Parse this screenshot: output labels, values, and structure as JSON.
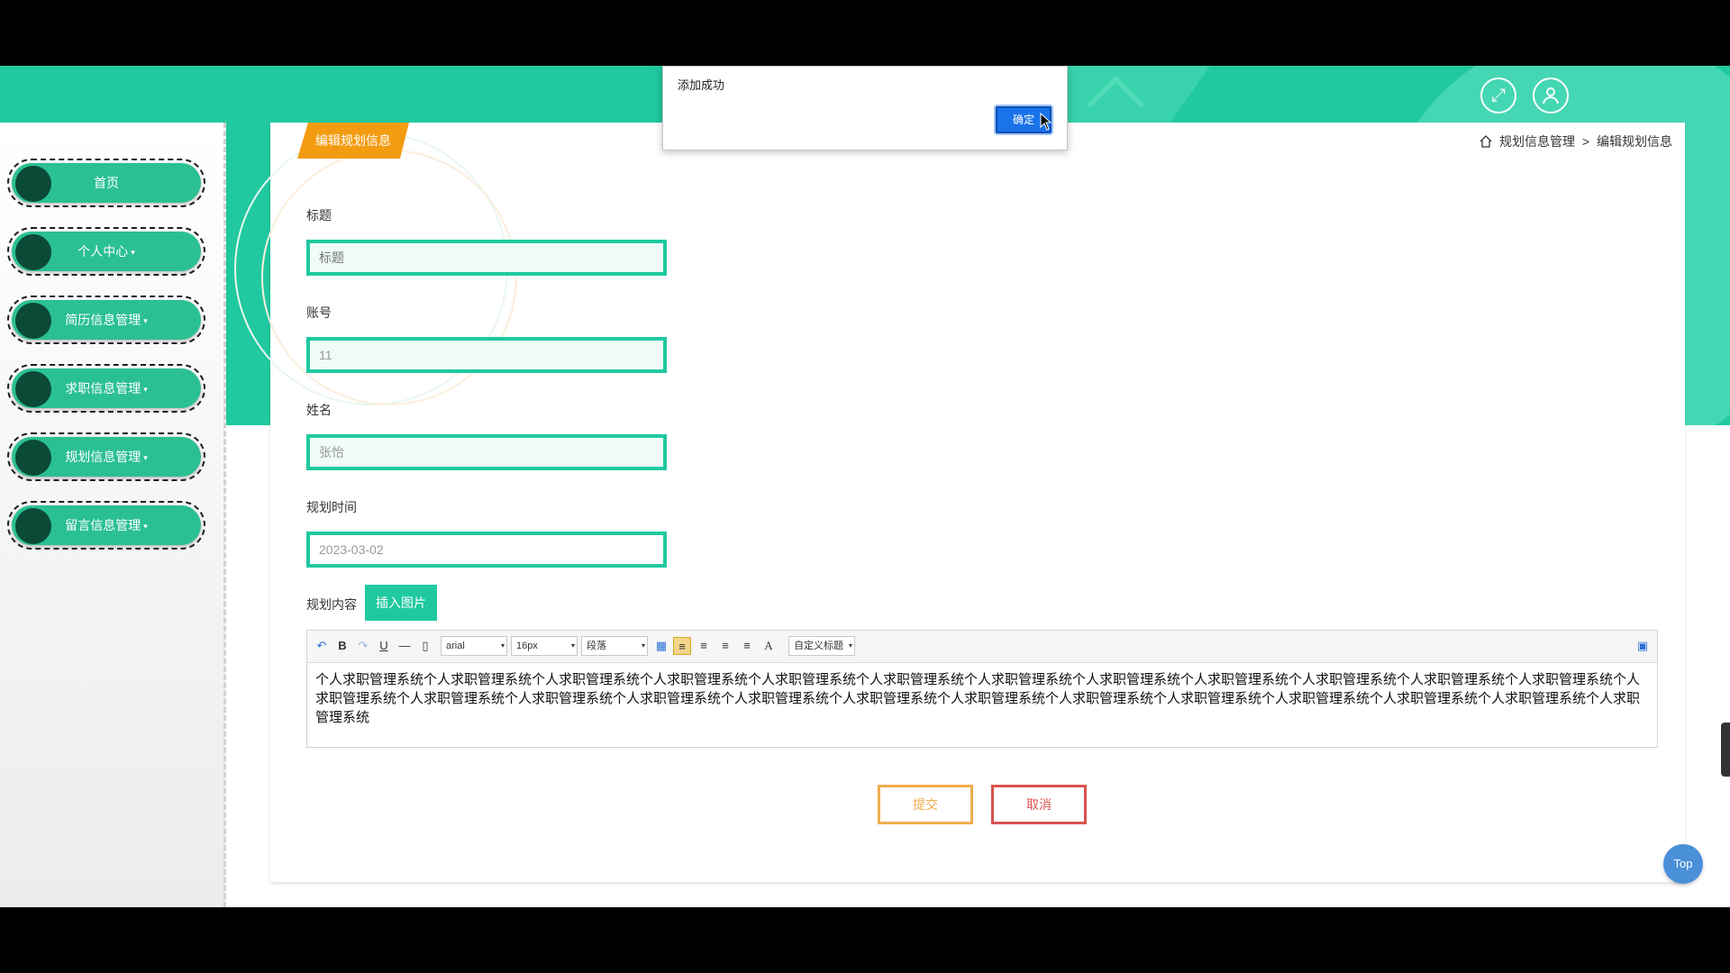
{
  "sidebar": {
    "items": [
      {
        "label": "首页",
        "caret": ""
      },
      {
        "label": "个人中心",
        "caret": "▾"
      },
      {
        "label": "简历信息管理",
        "caret": "▾"
      },
      {
        "label": "求职信息管理",
        "caret": "▾"
      },
      {
        "label": "规划信息管理",
        "caret": "▾"
      },
      {
        "label": "留言信息管理",
        "caret": "▾"
      }
    ]
  },
  "header": {
    "icons": [
      "fullscreen-icon",
      "user-icon"
    ]
  },
  "page": {
    "tab_title": "编辑规划信息",
    "breadcrumb": {
      "home_icon": "home-icon",
      "section": "规划信息管理",
      "separator": ">",
      "current": "编辑规划信息"
    }
  },
  "form": {
    "title": {
      "label": "标题",
      "placeholder": "标题",
      "value": ""
    },
    "account": {
      "label": "账号",
      "value": "11"
    },
    "name": {
      "label": "姓名",
      "value": "张怡"
    },
    "plan_time": {
      "label": "规划时间",
      "value": "2023-03-02"
    },
    "content": {
      "label": "规划内容",
      "insert_image_label": "插入图片",
      "toolbar": {
        "font": "arial",
        "size": "16px",
        "paragraph": "段落",
        "custom_title": "自定义标题"
      },
      "text": "个人求职管理系统个人求职管理系统个人求职管理系统个人求职管理系统个人求职管理系统个人求职管理系统个人求职管理系统个人求职管理系统个人求职管理系统个人求职管理系统个人求职管理系统个人求职管理系统个人求职管理系统个人求职管理系统个人求职管理系统个人求职管理系统个人求职管理系统个人求职管理系统个人求职管理系统个人求职管理系统个人求职管理系统个人求职管理系统个人求职管理系统个人求职管理系统个人求职管理系统"
    },
    "submit_label": "提交",
    "cancel_label": "取消"
  },
  "dialog": {
    "message": "添加成功",
    "ok_label": "确定"
  },
  "top_button": "Top",
  "colors": {
    "accent": "#20c9a0",
    "orange": "#f39c12",
    "danger": "#d9534f",
    "nav_dot": "#0b4a37"
  }
}
